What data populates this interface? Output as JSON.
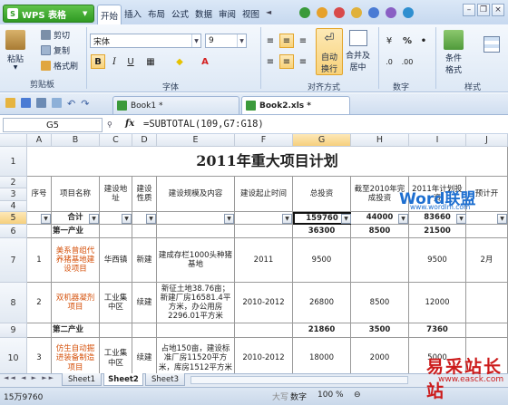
{
  "app": {
    "name": "WPS 表格",
    "logo": "S",
    "menus": [
      "开始",
      "插入",
      "布局",
      "公式",
      "数据",
      "审阅",
      "视图"
    ]
  },
  "ribbon": {
    "paste": "粘贴",
    "cut": "剪切",
    "copy": "复制",
    "format_painter": "格式刷",
    "font_name": "宋体",
    "font_size": "9",
    "wrap_line1": "自动",
    "wrap_line2": "换行",
    "merge_line1": "合并及",
    "merge_line2": "居中",
    "percent": "%",
    "comma": "•",
    "cond_line1": "条件",
    "cond_line2": "格式",
    "groups": {
      "clipboard": "剪贴板",
      "font": "字体",
      "align": "对齐方式",
      "number": "数字",
      "style": "样式"
    }
  },
  "doctabs": [
    {
      "label": "Book1 *",
      "active": false
    },
    {
      "label": "Book2.xls *",
      "active": true
    }
  ],
  "formula_bar": {
    "name_box": "G5",
    "fx": "fx",
    "formula": "=SUBTOTAL(109,G7:G18)"
  },
  "columns": [
    "A",
    "B",
    "C",
    "D",
    "E",
    "F",
    "G",
    "H",
    "I",
    "J"
  ],
  "rows": [
    "1",
    "2",
    "3",
    "4",
    "5",
    "6",
    "7",
    "8",
    "9",
    "10"
  ],
  "sheet": {
    "title": "2011年重大项目计划",
    "headers": {
      "a": "序号",
      "b": "项目名称",
      "c": "建设地址",
      "d": "建设性质",
      "e": "建设规模及内容",
      "f": "建设起止时间",
      "g": "总投资",
      "h": "截至2010年完成投资",
      "i": "2011年计划投资",
      "j": "预计开"
    },
    "row5": {
      "b": "合计",
      "g": "159760",
      "h": "44000",
      "i": "83660"
    },
    "row6": {
      "b": "第一产业",
      "g": "36300",
      "h": "8500",
      "i": "21500"
    },
    "row7": {
      "a": "1",
      "b": "美系曾组代养猪基地建设项目",
      "c": "华西镇",
      "d": "新建",
      "e": "建成存栏1000头种猪基地",
      "f": "2011",
      "g": "9500",
      "h": "",
      "i": "9500",
      "j": "2月"
    },
    "row8": {
      "a": "2",
      "b": "双机器凝剂项目",
      "c": "工业集中区",
      "d": "续建",
      "e": "新征土地38.76亩；新建厂房16581.4平方米，办公用房2296.01平方米",
      "f": "2010-2012",
      "g": "26800",
      "h": "8500",
      "i": "12000",
      "j": ""
    },
    "row9": {
      "b": "第二产业",
      "g": "21860",
      "h": "3500",
      "i": "7360"
    },
    "row10": {
      "a": "3",
      "b": "仿生自动掘进装备制造项目",
      "c": "工业集中区",
      "d": "续建",
      "e": "占地150亩，建设标准厂房11520平方米，库房1512平方米",
      "f": "2010-2012",
      "g": "18000",
      "h": "2000",
      "i": "5000",
      "j": ""
    }
  },
  "sheet_tabs": [
    "Sheet1",
    "Sheet2",
    "Sheet3"
  ],
  "active_sheet": "Sheet2",
  "status": {
    "sum": "15万9760",
    "caps": "大写",
    "num": "数字",
    "zoom": "100 %"
  },
  "watermark": {
    "main": "Word联盟",
    "url": "www.wordlm.com",
    "bottom": "易采站长站",
    "bottom_url": "www.easck.com"
  },
  "colors": {
    "accent": "#2f9a23",
    "ribbon": "#dde8f5",
    "selection": "#f6cf7d",
    "watermark": "#cc1b1b"
  }
}
